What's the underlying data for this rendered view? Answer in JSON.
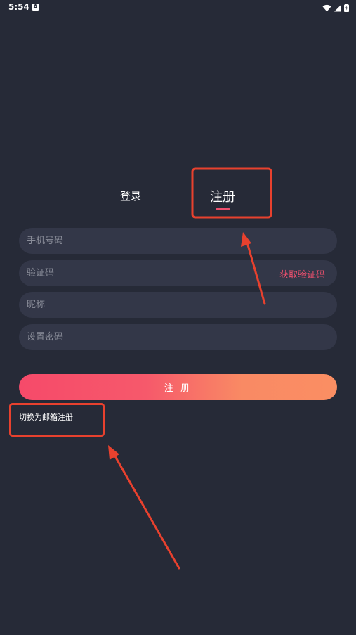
{
  "status_bar": {
    "time": "5:54",
    "notification_glyph": "A",
    "icons": [
      "wifi-icon",
      "signal-icon",
      "battery-icon"
    ]
  },
  "tabs": {
    "login_label": "登录",
    "register_label": "注册",
    "active": "register"
  },
  "form": {
    "phone_placeholder": "手机号码",
    "code_placeholder": "验证码",
    "get_code_label": "获取验证码",
    "nickname_placeholder": "昵称",
    "password_placeholder": "设置密码",
    "submit_label": "注 册",
    "switch_label": "切换为邮箱注册"
  },
  "colors": {
    "background": "#262a37",
    "field_background": "#333748",
    "accent": "#f0506e",
    "gradient_start": "#f64a6a",
    "gradient_end": "#fa8e63",
    "annotation": "#e8412e"
  }
}
